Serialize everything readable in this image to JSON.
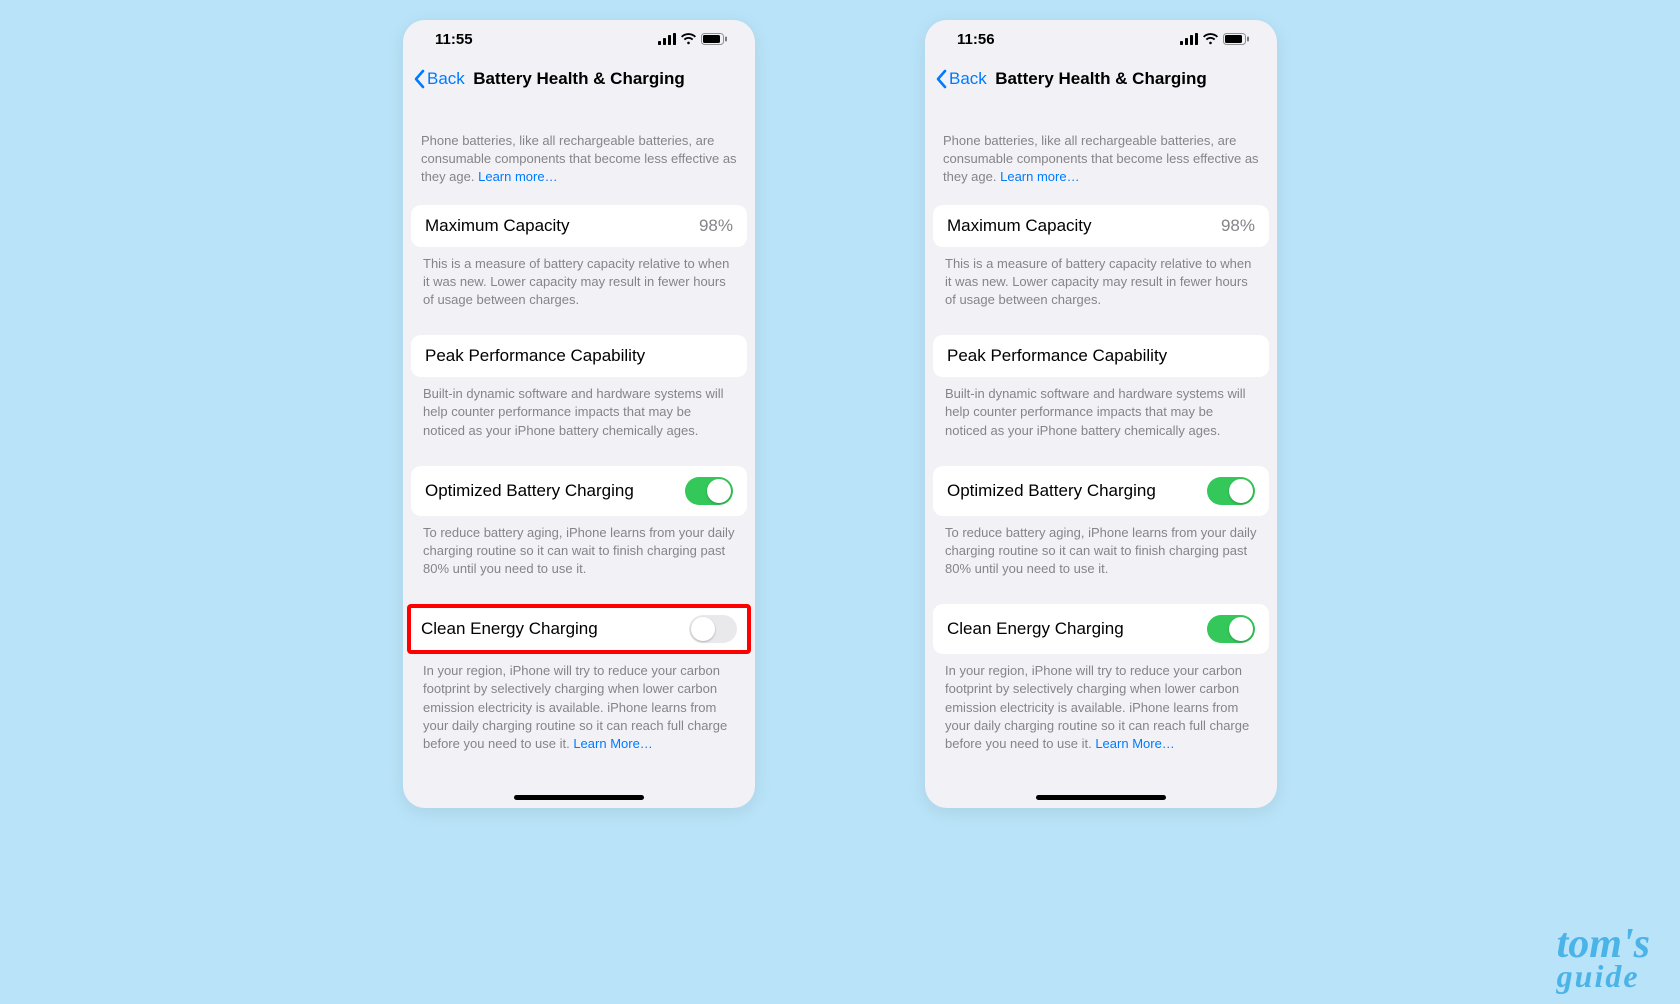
{
  "watermark": {
    "line1": "tom's",
    "line2": "guide"
  },
  "phones": [
    {
      "time": "11:55",
      "nav": {
        "back": "Back",
        "title": "Battery Health & Charging"
      },
      "intro": {
        "text": "Phone batteries, like all rechargeable batteries, are consumable components that become less effective as they age. ",
        "link": "Learn more…"
      },
      "capacity": {
        "label": "Maximum Capacity",
        "value": "98%",
        "foot": "This is a measure of battery capacity relative to when it was new. Lower capacity may result in fewer hours of usage between charges."
      },
      "peak": {
        "label": "Peak Performance Capability",
        "foot": "Built-in dynamic software and hardware systems will help counter performance impacts that may be noticed as your iPhone battery chemically ages."
      },
      "optimized": {
        "label": "Optimized Battery Charging",
        "on": true,
        "foot": "To reduce battery aging, iPhone learns from your daily charging routine so it can wait to finish charging past 80% until you need to use it."
      },
      "clean": {
        "label": "Clean Energy Charging",
        "on": false,
        "highlight": true,
        "foot": "In your region, iPhone will try to reduce your carbon footprint by selectively charging when lower carbon emission electricity is available. iPhone learns from your daily charging routine so it can reach full charge before you need to use it. ",
        "link": "Learn More…"
      }
    },
    {
      "time": "11:56",
      "nav": {
        "back": "Back",
        "title": "Battery Health & Charging"
      },
      "intro": {
        "text": "Phone batteries, like all rechargeable batteries, are consumable components that become less effective as they age. ",
        "link": "Learn more…"
      },
      "capacity": {
        "label": "Maximum Capacity",
        "value": "98%",
        "foot": "This is a measure of battery capacity relative to when it was new. Lower capacity may result in fewer hours of usage between charges."
      },
      "peak": {
        "label": "Peak Performance Capability",
        "foot": "Built-in dynamic software and hardware systems will help counter performance impacts that may be noticed as your iPhone battery chemically ages."
      },
      "optimized": {
        "label": "Optimized Battery Charging",
        "on": true,
        "foot": "To reduce battery aging, iPhone learns from your daily charging routine so it can wait to finish charging past 80% until you need to use it."
      },
      "clean": {
        "label": "Clean Energy Charging",
        "on": true,
        "highlight": false,
        "foot": "In your region, iPhone will try to reduce your carbon footprint by selectively charging when lower carbon emission electricity is available. iPhone learns from your daily charging routine so it can reach full charge before you need to use it. ",
        "link": "Learn More…"
      }
    }
  ]
}
